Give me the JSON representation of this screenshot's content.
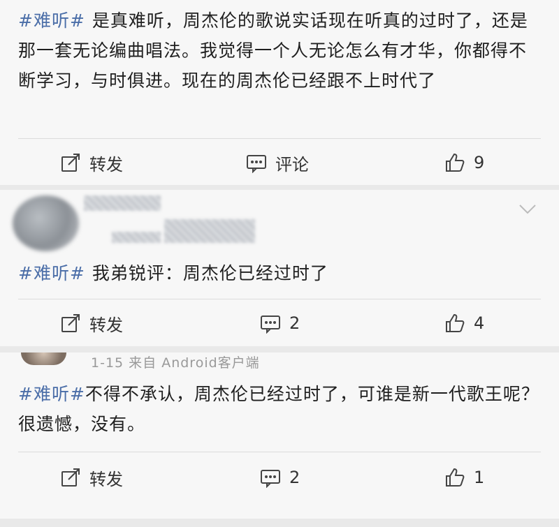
{
  "posts": [
    {
      "hashtag": "#难听#",
      "text": "是真难听，周杰伦的歌说实话现在听真的过时了，还是那一套无论编曲唱法。我觉得一个人无论怎么有才华，你都得不断学习，与时俱进。现在的周杰伦已经跟不上时代了",
      "repost_label": "转发",
      "comment_label": "评论",
      "like_count": "9"
    },
    {
      "hashtag": "#难听#",
      "text": "我弟锐评：周杰伦已经过时了",
      "repost_label": "转发",
      "comment_count": "2",
      "like_count": "4"
    },
    {
      "meta": "1-15 来自 Android客户端",
      "hashtag": "#难听#",
      "text": "不得不承认，周杰伦已经过时了，可谁是新一代歌王呢？很遗憾，没有。",
      "repost_label": "转发",
      "comment_count": "2",
      "like_count": "1"
    }
  ],
  "icons": {
    "repost": "share-edit-icon",
    "comment": "comment-icon",
    "like": "thumbs-up-icon",
    "chevron": "chevron-down-icon"
  },
  "colors": {
    "hashtag": "#4b6ea8",
    "background": "#f7f7f7"
  }
}
